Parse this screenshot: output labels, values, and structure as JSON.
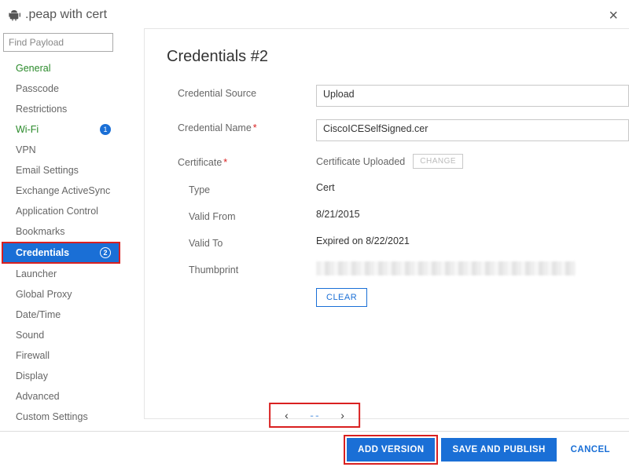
{
  "header": {
    "title": ".peap with cert"
  },
  "sidebar": {
    "search_placeholder": "Find Payload",
    "items": [
      {
        "label": "General",
        "green": true
      },
      {
        "label": "Passcode"
      },
      {
        "label": "Restrictions"
      },
      {
        "label": "Wi-Fi",
        "green": true,
        "badge": "1"
      },
      {
        "label": "VPN"
      },
      {
        "label": "Email Settings"
      },
      {
        "label": "Exchange ActiveSync"
      },
      {
        "label": "Application Control"
      },
      {
        "label": "Bookmarks"
      },
      {
        "label": "Credentials",
        "selected": true,
        "badge": "2"
      },
      {
        "label": "Launcher"
      },
      {
        "label": "Global Proxy"
      },
      {
        "label": "Date/Time"
      },
      {
        "label": "Sound"
      },
      {
        "label": "Firewall"
      },
      {
        "label": "Display"
      },
      {
        "label": "Advanced"
      },
      {
        "label": "Custom Settings"
      }
    ]
  },
  "form": {
    "title": "Credentials #2",
    "source_label": "Credential Source",
    "source_value": "Upload",
    "name_label": "Credential Name",
    "name_value": "CiscoICESelfSigned.cer",
    "cert_label": "Certificate",
    "uploaded_text": "Certificate Uploaded",
    "change_btn": "CHANGE",
    "type_label": "Type",
    "type_value": "Cert",
    "valid_from_label": "Valid From",
    "valid_from_value": "8/21/2015",
    "valid_to_label": "Valid To",
    "valid_to_value": "Expired on 8/22/2021",
    "thumb_label": "Thumbprint",
    "clear_btn": "CLEAR"
  },
  "pager": {
    "mid": "˗  ˗"
  },
  "footer": {
    "add_version": "ADD VERSION",
    "save_publish": "SAVE AND PUBLISH",
    "cancel": "CANCEL"
  }
}
